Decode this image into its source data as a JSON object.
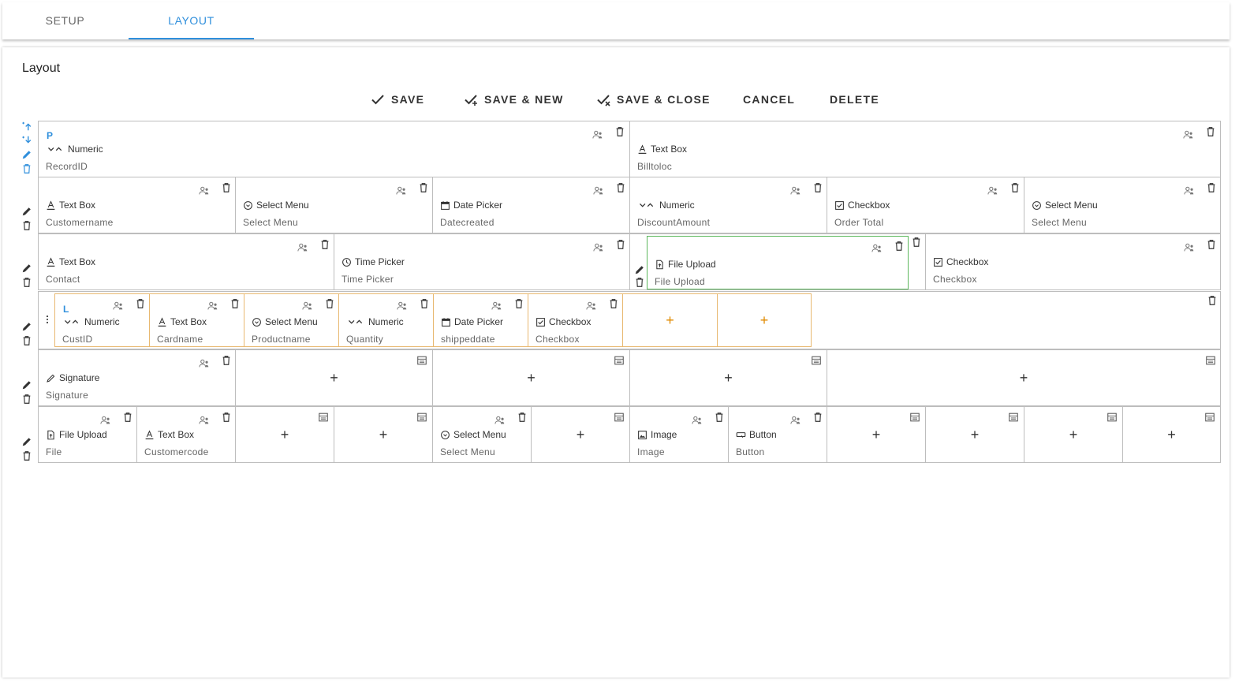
{
  "tabs": [
    "SETUP",
    "LAYOUT"
  ],
  "page_title": "Layout",
  "actions": {
    "save": "SAVE",
    "save_new": "SAVE & NEW",
    "save_close": "SAVE & CLOSE",
    "cancel": "CANCEL",
    "delete": "DELETE"
  },
  "rows": {
    "r1": {
      "marker": "P",
      "c1": {
        "type": "Numeric",
        "name": "RecordID"
      },
      "c2": {
        "type": "Text Box",
        "name": "Billtoloc"
      }
    },
    "r2": {
      "c1": {
        "type": "Text Box",
        "name": "Customername"
      },
      "c2": {
        "type": "Select Menu",
        "name": "Select Menu"
      },
      "c3": {
        "type": "Date Picker",
        "name": "Datecreated"
      },
      "c4": {
        "type": "Numeric",
        "name": "DiscountAmount"
      },
      "c5": {
        "type": "Checkbox",
        "name": "Order Total"
      },
      "c6": {
        "type": "Select Menu",
        "name": "Select Menu"
      }
    },
    "r3": {
      "c1": {
        "type": "Text Box",
        "name": "Contact"
      },
      "c2": {
        "type": "Time Picker",
        "name": "Time Picker"
      },
      "c3": {
        "type": "File Upload",
        "name": "File Upload"
      },
      "c4": {
        "type": "Checkbox",
        "name": "Checkbox"
      }
    },
    "r4": {
      "marker": "L",
      "c1": {
        "type": "Numeric",
        "name": "CustID"
      },
      "c2": {
        "type": "Text Box",
        "name": "Cardname"
      },
      "c3": {
        "type": "Select Menu",
        "name": "Productname"
      },
      "c4": {
        "type": "Numeric",
        "name": "Quantity"
      },
      "c5": {
        "type": "Date Picker",
        "name": "shippeddate"
      },
      "c6": {
        "type": "Checkbox",
        "name": "Checkbox"
      }
    },
    "r5": {
      "c1": {
        "type": "Signature",
        "name": "Signature"
      }
    },
    "r6": {
      "c1": {
        "type": "File Upload",
        "name": "File"
      },
      "c2": {
        "type": "Text Box",
        "name": "Customercode"
      },
      "c5": {
        "type": "Select Menu",
        "name": "Select Menu"
      },
      "c7": {
        "type": "Image",
        "name": "Image"
      },
      "c8": {
        "type": "Button",
        "name": "Button"
      }
    }
  },
  "plus_symbol": "+",
  "icons": [
    "person-permissions-icon",
    "trash-icon",
    "pencil-icon",
    "calendar-icon",
    "clock-icon",
    "checkbox-icon",
    "select-circle-icon",
    "text-a-icon",
    "file-upload-icon",
    "image-icon",
    "button-icon",
    "card-layout-icon",
    "chevron-up-down-icon",
    "drag-handle-icon",
    "move-up-icon",
    "move-down-icon"
  ],
  "colors": {
    "accent": "#2f8fdc",
    "nested_border": "#e8b870",
    "selected_border": "#5cb85c",
    "plus_orange": "#e08a00"
  }
}
